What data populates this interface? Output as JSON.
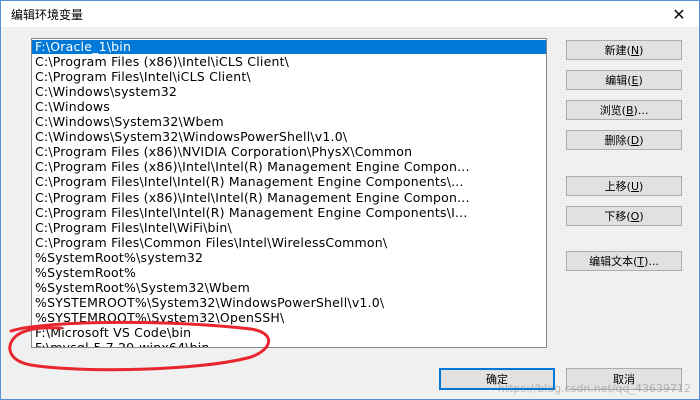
{
  "window": {
    "title": "编辑环境变量",
    "close_symbol": "✕"
  },
  "paths": [
    "F:\\Oracle_1\\bin",
    "C:\\Program Files (x86)\\Intel\\iCLS Client\\",
    "C:\\Program Files\\Intel\\iCLS Client\\",
    "C:\\Windows\\system32",
    "C:\\Windows",
    "C:\\Windows\\System32\\Wbem",
    "C:\\Windows\\System32\\WindowsPowerShell\\v1.0\\",
    "C:\\Program Files (x86)\\NVIDIA Corporation\\PhysX\\Common",
    "C:\\Program Files (x86)\\Intel\\Intel(R) Management Engine Compon...",
    "C:\\Program Files\\Intel\\Intel(R) Management Engine Components\\...",
    "C:\\Program Files (x86)\\Intel\\Intel(R) Management Engine Compon...",
    "C:\\Program Files\\Intel\\Intel(R) Management Engine Components\\I...",
    "C:\\Program Files\\Intel\\WiFi\\bin\\",
    "C:\\Program Files\\Common Files\\Intel\\WirelessCommon\\",
    "%SystemRoot%\\system32",
    "%SystemRoot%",
    "%SystemRoot%\\System32\\Wbem",
    "%SYSTEMROOT%\\System32\\WindowsPowerShell\\v1.0\\",
    "%SYSTEMROOT%\\System32\\OpenSSH\\",
    "F:\\Microsoft VS Code\\bin",
    "F:\\mysql-5.7.29-winx64\\bin"
  ],
  "selected_index": 0,
  "buttons": {
    "new": {
      "label": "新建(",
      "key": "N",
      "suffix": ")"
    },
    "edit": {
      "label": "编辑(",
      "key": "E",
      "suffix": ")"
    },
    "browse": {
      "label": "浏览(",
      "key": "B",
      "suffix": ")..."
    },
    "delete": {
      "label": "删除(",
      "key": "D",
      "suffix": ")"
    },
    "up": {
      "label": "上移(",
      "key": "U",
      "suffix": ")"
    },
    "down": {
      "label": "下移(",
      "key": "O",
      "suffix": ")"
    },
    "edit_text": {
      "label": "编辑文本(",
      "key": "T",
      "suffix": ")..."
    }
  },
  "footer": {
    "ok": "确定",
    "cancel": "取消"
  },
  "watermark": "https://blog.csdn.net/qq_43639712",
  "colors": {
    "selection": "#0078d7",
    "annotation": "#e8262d"
  }
}
